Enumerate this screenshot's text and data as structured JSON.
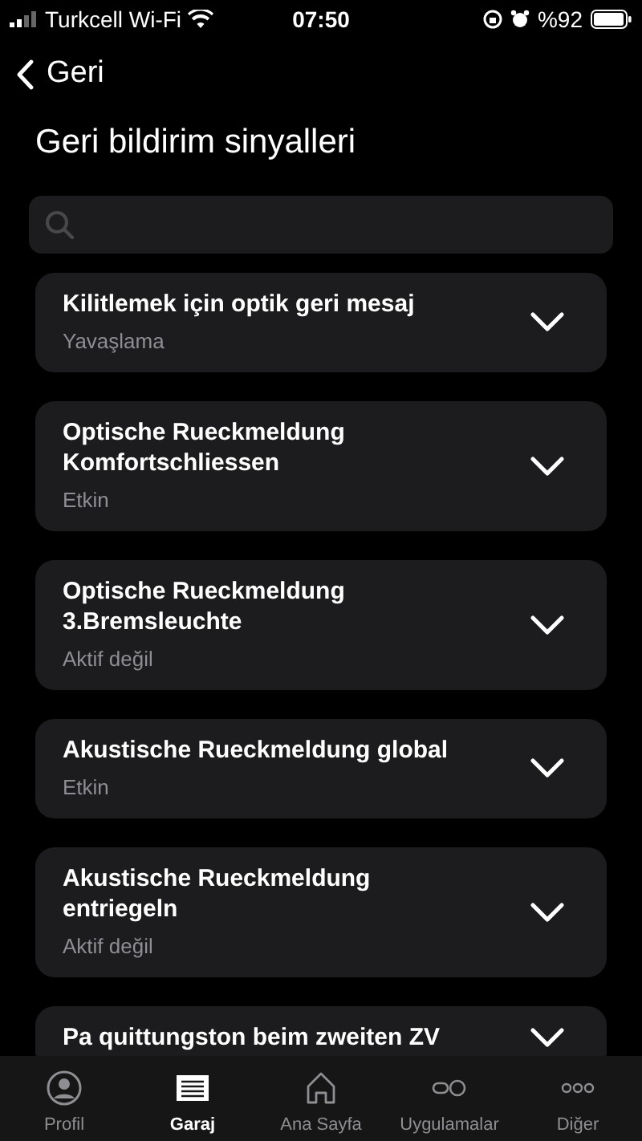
{
  "status_bar": {
    "carrier": "Turkcell Wi-Fi",
    "time": "07:50",
    "battery": "%92"
  },
  "nav": {
    "back": "Geri"
  },
  "title": "Geri bildirim sinyalleri",
  "items": [
    {
      "title": "Kilitlemek için optik geri mesaj",
      "value": "Yavaşlama"
    },
    {
      "title": "Optische Rueckmeldung Komfortschliessen",
      "value": "Etkin"
    },
    {
      "title": "Optische Rueckmeldung 3.Bremsleuchte",
      "value": "Aktif değil"
    },
    {
      "title": "Akustische Rueckmeldung global",
      "value": "Etkin"
    },
    {
      "title": "Akustische Rueckmeldung entriegeln",
      "value": "Aktif değil"
    },
    {
      "title": "Pa quittungston beim zweiten ZV"
    }
  ],
  "tabs": [
    {
      "kind": "profile",
      "label": "Profil",
      "selected": false
    },
    {
      "kind": "garage",
      "label": "Garaj",
      "selected": true
    },
    {
      "kind": "home",
      "label": "Ana Sayfa",
      "selected": false
    },
    {
      "kind": "apps",
      "label": "Uygulamalar",
      "selected": false
    },
    {
      "kind": "more",
      "label": "Diğer",
      "selected": false
    }
  ]
}
